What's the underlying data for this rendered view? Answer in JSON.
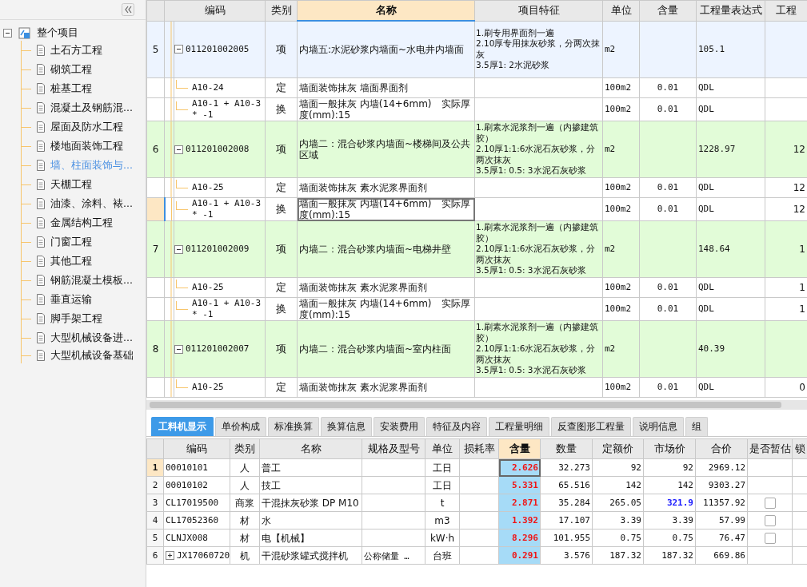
{
  "sidebar": {
    "root": {
      "label": "整个项目",
      "expanded": true,
      "children": [
        {
          "label": "土石方工程",
          "selected": false
        },
        {
          "label": "砌筑工程",
          "selected": false
        },
        {
          "label": "桩基工程",
          "selected": false
        },
        {
          "label": "混凝土及钢筋混...",
          "selected": false
        },
        {
          "label": "屋面及防水工程",
          "selected": false
        },
        {
          "label": "楼地面装饰工程",
          "selected": false
        },
        {
          "label": "墙、柱面装饰与...",
          "selected": true
        },
        {
          "label": "天棚工程",
          "selected": false
        },
        {
          "label": "油漆、涂料、裱...",
          "selected": false
        },
        {
          "label": "金属结构工程",
          "selected": false
        },
        {
          "label": "门窗工程",
          "selected": false
        },
        {
          "label": "其他工程",
          "selected": false
        },
        {
          "label": "钢筋混凝土模板...",
          "selected": false
        },
        {
          "label": "垂直运输",
          "selected": false
        },
        {
          "label": "脚手架工程",
          "selected": false
        },
        {
          "label": "大型机械设备进...",
          "selected": false
        },
        {
          "label": "大型机械设备基础",
          "selected": false
        }
      ]
    }
  },
  "main_table": {
    "columns": [
      {
        "label": "编码",
        "sorted": false
      },
      {
        "label": "类别",
        "sorted": false
      },
      {
        "label": "名称",
        "sorted": true
      },
      {
        "label": "项目特征",
        "sorted": false
      },
      {
        "label": "单位",
        "sorted": false
      },
      {
        "label": "含量",
        "sorted": false
      },
      {
        "label": "工程量表达式",
        "sorted": false
      },
      {
        "label": "工程",
        "sorted": false
      }
    ],
    "rows": [
      {
        "kind": "item",
        "number": "5",
        "code": "011201002005",
        "type": "项",
        "name": "内墙五:水泥砂浆内墙面~水电井内墙面",
        "feature": [
          "1.刷专用界面剂一遍",
          "2.10厚专用抹灰砂浆，分两次抹灰",
          "3.5厚1: 2水泥砂浆"
        ],
        "unit": "m2",
        "expression": "105.1",
        "expanded": true,
        "color": "#edf4ff",
        "selected": false
      },
      {
        "kind": "sub",
        "code": "A10-24",
        "type": "定",
        "name": "墙面装饰抹灰 墙面界面剂",
        "unit": "100m2",
        "amount": "0.01",
        "expression": "QDL",
        "selected": false
      },
      {
        "kind": "sub",
        "code": "A10-1 + A10-3 * -1",
        "type": "换",
        "name": "墙面一般抹灰 内墙(14+6mm)　实际厚度(mm):15",
        "unit": "100m2",
        "amount": "0.01",
        "expression": "QDL",
        "selected": false
      },
      {
        "kind": "item",
        "number": "6",
        "code": "011201002008",
        "type": "项",
        "name": "内墙二：混合砂浆内墙面~楼梯间及公共区域",
        "feature": [
          "1.刷素水泥浆剂一遍（内掺建筑胶）",
          "2.10厚1:1:6水泥石灰砂浆，分两次抹灰",
          "3.5厚1: 0.5: 3水泥石灰砂浆"
        ],
        "unit": "m2",
        "expression": "1228.97",
        "quantity": "12",
        "expanded": true,
        "color": "#e2fcd8",
        "selected": false
      },
      {
        "kind": "sub",
        "code": "A10-25",
        "type": "定",
        "name": "墙面装饰抹灰 素水泥浆界面剂",
        "unit": "100m2",
        "amount": "0.01",
        "expression": "QDL",
        "quantity": "12",
        "selected": false
      },
      {
        "kind": "sub",
        "code": "A10-1 + A10-3 * -1",
        "type": "换",
        "name": "墙面一般抹灰 内墙(14+6mm)　实际厚度(mm):15",
        "unit": "100m2",
        "amount": "0.01",
        "expression": "QDL",
        "quantity": "12",
        "selected": true
      },
      {
        "kind": "item",
        "number": "7",
        "code": "011201002009",
        "type": "项",
        "name": "内墙二：混合砂浆内墙面~电梯井壁",
        "feature": [
          "1.刷素水泥浆剂一遍（内掺建筑胶）",
          "2.10厚1:1:6水泥石灰砂浆，分两次抹灰",
          "3.5厚1: 0.5: 3水泥石灰砂浆"
        ],
        "unit": "m2",
        "expression": "148.64",
        "quantity": "1",
        "expanded": true,
        "color": "#e2fcd8",
        "selected": false
      },
      {
        "kind": "sub",
        "code": "A10-25",
        "type": "定",
        "name": "墙面装饰抹灰 素水泥浆界面剂",
        "unit": "100m2",
        "amount": "0.01",
        "expression": "QDL",
        "quantity": "1",
        "selected": false
      },
      {
        "kind": "sub",
        "code": "A10-1 + A10-3 * -1",
        "type": "换",
        "name": "墙面一般抹灰 内墙(14+6mm)　实际厚度(mm):15",
        "unit": "100m2",
        "amount": "0.01",
        "expression": "QDL",
        "quantity": "1",
        "selected": false
      },
      {
        "kind": "item",
        "number": "8",
        "code": "011201002007",
        "type": "项",
        "name": "内墙二：混合砂浆内墙面~室内柱面",
        "feature": [
          "1.刷素水泥浆剂一遍（内掺建筑胶）",
          "2.10厚1:1:6水泥石灰砂浆，分两次抹灰",
          "3.5厚1: 0.5: 3水泥石灰砂浆"
        ],
        "unit": "m2",
        "expression": "40.39",
        "expanded": true,
        "color": "#e2fcd8",
        "selected": false
      },
      {
        "kind": "sub",
        "code": "A10-25",
        "type": "定",
        "name": "墙面装饰抹灰 素水泥浆界面剂",
        "unit": "100m2",
        "amount": "0.01",
        "expression": "QDL",
        "quantity": "0",
        "selected": false
      }
    ]
  },
  "tabs": [
    {
      "label": "工料机显示",
      "selected": true
    },
    {
      "label": "单价构成",
      "selected": false
    },
    {
      "label": "标准换算",
      "selected": false
    },
    {
      "label": "换算信息",
      "selected": false
    },
    {
      "label": "安装费用",
      "selected": false
    },
    {
      "label": "特征及内容",
      "selected": false
    },
    {
      "label": "工程量明细",
      "selected": false
    },
    {
      "label": "反查图形工程量",
      "selected": false
    },
    {
      "label": "说明信息",
      "selected": false
    },
    {
      "label": "组",
      "selected": false
    }
  ],
  "resource_table": {
    "columns": [
      {
        "label": "编码",
        "sorted": false
      },
      {
        "label": "类别",
        "sorted": false
      },
      {
        "label": "名称",
        "sorted": false
      },
      {
        "label": "规格及型号",
        "sorted": false
      },
      {
        "label": "单位",
        "sorted": false
      },
      {
        "label": "损耗率",
        "sorted": false
      },
      {
        "label": "含量",
        "sorted": true
      },
      {
        "label": "数量",
        "sorted": false
      },
      {
        "label": "定额价",
        "sorted": false
      },
      {
        "label": "市场价",
        "sorted": false
      },
      {
        "label": "合价",
        "sorted": false
      },
      {
        "label": "是否暂估",
        "sorted": false
      },
      {
        "label": "锁",
        "sorted": false
      }
    ],
    "rows": [
      {
        "number": "1",
        "code": "00010101",
        "type": "人",
        "name": "普工",
        "unit": "工日",
        "amount": "2.626",
        "quantity": "32.273",
        "quota_price": "92",
        "market_price": "2969.12",
        "market_modified": false,
        "selected": true,
        "market": "92"
      },
      {
        "number": "2",
        "code": "00010102",
        "type": "人",
        "name": "技工",
        "unit": "工日",
        "amount": "5.331",
        "quantity": "65.516",
        "quota_price": "142",
        "market": "142",
        "market_price": "9303.27",
        "market_modified": false,
        "selected": false
      },
      {
        "number": "3",
        "code": "CL17019500",
        "type": "商浆",
        "name": "干混抹灰砂浆 DP M10",
        "unit": "t",
        "amount": "2.871",
        "quantity": "35.284",
        "quota_price": "265.05",
        "market": "321.9",
        "market_price": "11357.92",
        "market_modified": true,
        "provisional": false,
        "selected": false
      },
      {
        "number": "4",
        "code": "CL17052360",
        "type": "材",
        "name": "水",
        "unit": "m3",
        "amount": "1.392",
        "quantity": "17.107",
        "quota_price": "3.39",
        "market": "3.39",
        "market_price": "57.99",
        "market_modified": false,
        "provisional": false,
        "selected": false
      },
      {
        "number": "5",
        "code": "CLNJX008",
        "type": "材",
        "name": "电【机械】",
        "unit": "kW·h",
        "amount": "8.296",
        "quantity": "101.955",
        "quota_price": "0.75",
        "market": "0.75",
        "market_price": "76.47",
        "market_modified": false,
        "provisional": false,
        "selected": false
      },
      {
        "number": "6",
        "code": "JX17060720",
        "type": "机",
        "name": "干混砂浆罐式搅拌机",
        "spec": "公称储量 …",
        "unit": "台班",
        "amount": "0.291",
        "quantity": "3.576",
        "quota_price": "187.32",
        "market": "187.32",
        "market_price": "669.86",
        "market_modified": false,
        "expanded": false,
        "selected": false
      }
    ]
  }
}
